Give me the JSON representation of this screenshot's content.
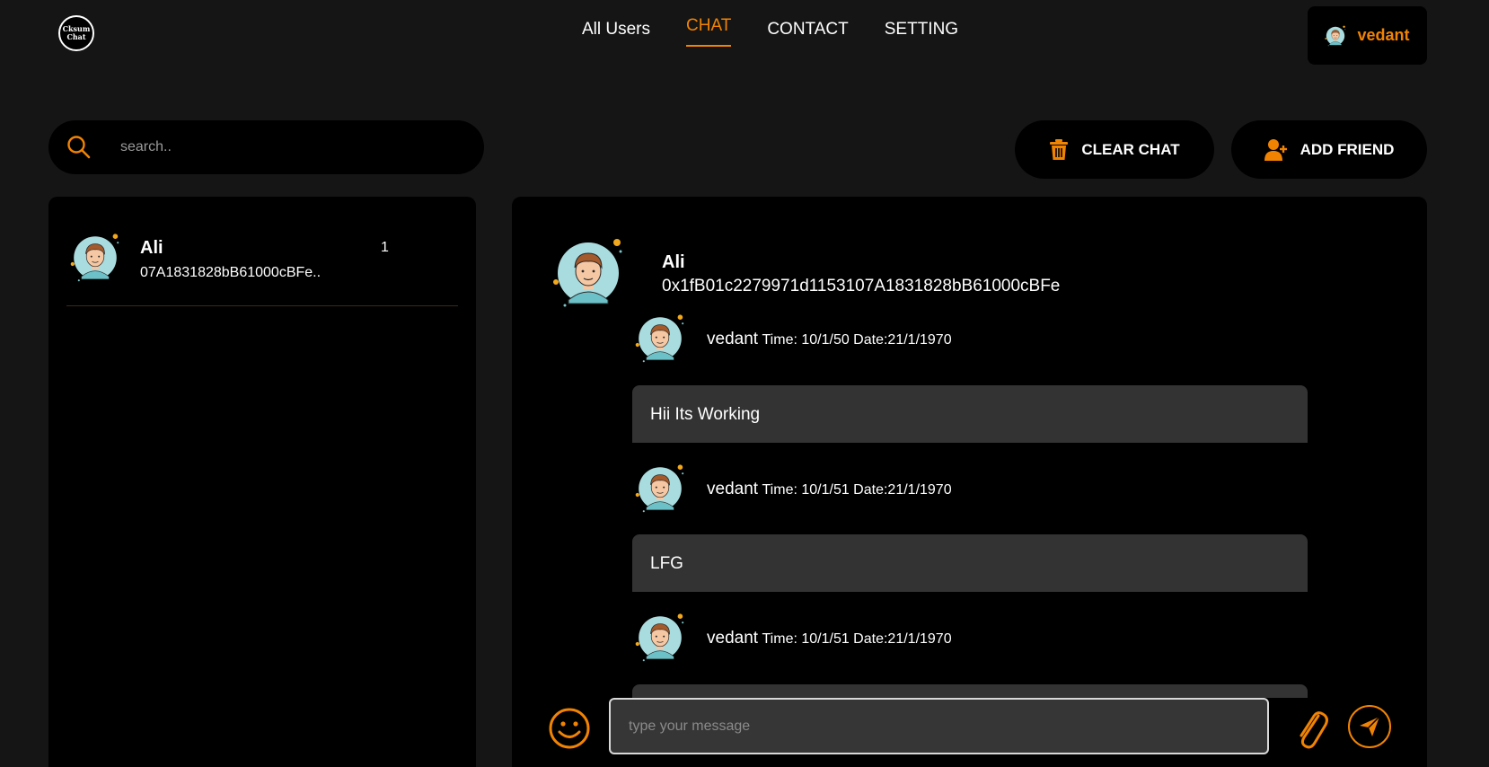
{
  "header": {
    "logo_line1": "Cksum",
    "logo_line2": "Chat",
    "nav": [
      "All Users",
      "CHAT",
      "CONTACT",
      "SETTING"
    ],
    "active_nav": "CHAT",
    "user_name": "vedant"
  },
  "search": {
    "placeholder": "search.."
  },
  "actions": {
    "clear_chat": "CLEAR CHAT",
    "add_friend": "ADD FRIEND"
  },
  "friends": [
    {
      "name": "Ali",
      "address": "07A1831828bB61000cBFe..",
      "unread": "1"
    }
  ],
  "chat": {
    "name": "Ali",
    "address": "0x1fB01c2279971d1153107A1831828bB61000cBFe",
    "messages": [
      {
        "sender": "vedant",
        "time": "Time: 10/1/50 Date:21/1/1970",
        "text": "Hii Its Working"
      },
      {
        "sender": "vedant",
        "time": "Time: 10/1/51 Date:21/1/1970",
        "text": "LFG"
      },
      {
        "sender": "vedant",
        "time": "Time: 10/1/51 Date:21/1/1970",
        "text": ""
      }
    ],
    "input_placeholder": "type your message"
  },
  "colors": {
    "accent": "#f18303",
    "panel": "#000000",
    "background": "#151515",
    "bubble": "#333333"
  },
  "icons": [
    "search-icon",
    "trash-icon",
    "add-user-icon",
    "emoji-icon",
    "paperclip-icon",
    "send-icon",
    "avatar"
  ]
}
